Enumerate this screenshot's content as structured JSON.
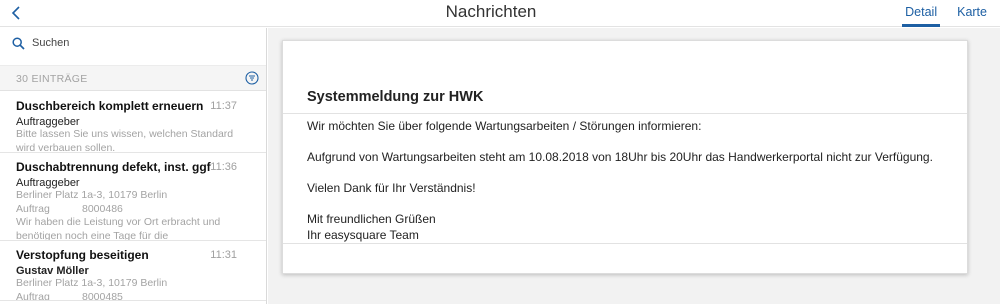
{
  "header": {
    "title": "Nachrichten",
    "tabs": [
      {
        "label": "Detail",
        "active": true
      },
      {
        "label": "Karte",
        "active": false
      }
    ]
  },
  "sidebar": {
    "search_placeholder": "Suchen",
    "count_label": "30 EINTRÄGE",
    "messages": [
      {
        "subject": "Duschbereich komplett erneuern",
        "time": "11:37",
        "sender": "Auftraggeber",
        "lines": [
          "Bitte lassen Sie uns wissen, welchen Standard",
          "wird verbauen sollen."
        ]
      },
      {
        "subject": "Duschabtrennung defekt, inst. ggf",
        "time": "11:36",
        "sender": "Auftraggeber",
        "address": "Berliner Platz 1a-3, 10179 Berlin",
        "order_label": "Auftrag",
        "order_number": "8000486",
        "lines": [
          "Wir haben die Leistung vor Ort erbracht und",
          "benötigen noch eine Tage für die"
        ]
      },
      {
        "subject": "Verstopfung beseitigen",
        "time": "11:31",
        "sender": "Gustav Möller",
        "address": "Berliner Platz 1a-3, 10179 Berlin",
        "order_label": "Auftrag",
        "order_number": "8000485"
      }
    ]
  },
  "detail": {
    "title": "Systemmeldung zur HWK",
    "paragraphs": [
      "Wir möchten Sie über folgende Wartungsarbeiten / Störungen informieren:",
      "Aufgrund von Wartungsarbeiten steht am 10.08.2018 von 18Uhr bis 20Uhr das Handwerkerportal nicht zur Verfügung.",
      "Vielen Dank für Ihr Verständnis!"
    ],
    "closing": "Mit freundlichen Grüßen",
    "signature": "Ihr easysquare Team"
  },
  "colors": {
    "accent": "#1d5fa3",
    "muted_text": "#a3a3a3",
    "main_background": "#f2f2f2"
  },
  "icons": [
    "chevron-left-icon",
    "search-icon",
    "filter-icon"
  ]
}
